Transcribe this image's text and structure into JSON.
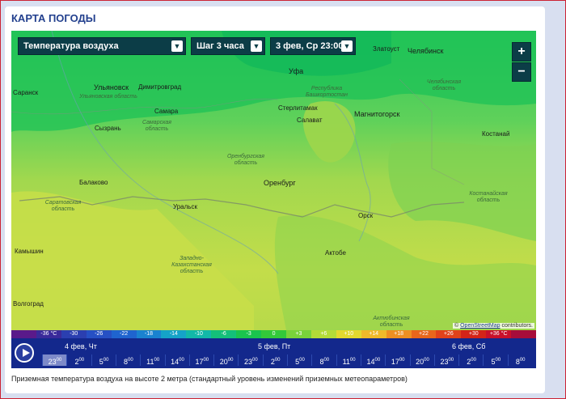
{
  "page_title": "КАРТА ПОГОДЫ",
  "controls": {
    "layer": "Температура воздуха",
    "step": "Шаг 3 часа",
    "datetime": "3 фев, Ср 23:00",
    "zoom_in": "+",
    "zoom_out": "−"
  },
  "map": {
    "cities": [
      "Златоуст",
      "Челябинск",
      "Уфа",
      "Саранск",
      "Ульяновск",
      "Димитровград",
      "Самара",
      "Сызрань",
      "Стерлитамак",
      "Салават",
      "Магнитогорск",
      "Костанай",
      "Балаково",
      "Оренбург",
      "Уральск",
      "Орск",
      "Актобе",
      "Камышин",
      "Волгоград"
    ],
    "regions": [
      "Ульяновская область",
      "Самарская область",
      "Республика Башкортостан",
      "Челябинская область",
      "Оренбургская область",
      "Саратовская область",
      "Костанайская область",
      "Западно-Казахстанская область",
      "Актюбинская область"
    ],
    "attribution_prefix": "© ",
    "attribution_link": "OpenStreetMap",
    "attribution_suffix": " contributors."
  },
  "scale": {
    "labels": [
      "",
      "-36 °C",
      "-30",
      "-26",
      "-22",
      "-18",
      "-14",
      "-10",
      "-6",
      "-3",
      "0",
      "+3",
      "+6",
      "+10",
      "+14",
      "+18",
      "+22",
      "+26",
      "+30",
      "+36 °C",
      ""
    ],
    "colors": [
      "#5a1a8a",
      "#3a2a9a",
      "#2b3fb0",
      "#2650c4",
      "#1f64cf",
      "#1a82d0",
      "#15a3c8",
      "#12b8a8",
      "#14c07a",
      "#1ac44e",
      "#33c93a",
      "#79d43a",
      "#b3dc38",
      "#e3d92f",
      "#f0b92a",
      "#ee8f22",
      "#e8661b",
      "#e0421a",
      "#d32418",
      "#c8102a",
      "#a70d3a"
    ]
  },
  "timeline": {
    "days": [
      "4 фев, Чт",
      "5 фев, Пт",
      "6 фев, Сб"
    ],
    "hours": [
      "23",
      "2",
      "5",
      "8",
      "11",
      "14",
      "17",
      "20",
      "23",
      "2",
      "5",
      "8",
      "11",
      "14",
      "17",
      "20",
      "23",
      "2",
      "5",
      "8"
    ],
    "minutes": "00",
    "selected_index": 0
  },
  "caption": "Приземная температура воздуха на высоте 2 метра (стандартный уровень изменений приземных метеопараметров)"
}
